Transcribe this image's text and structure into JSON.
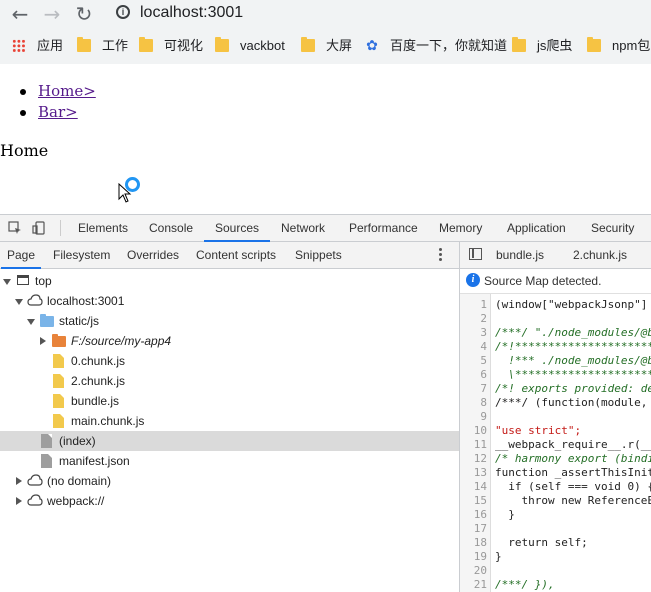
{
  "browser": {
    "url": "localhost:3001",
    "bookmarks": [
      {
        "label": "应用",
        "icon": "apps-grid-icon"
      },
      {
        "label": "工作",
        "icon": "folder-icon"
      },
      {
        "label": "可视化",
        "icon": "folder-icon"
      },
      {
        "label": "vackbot",
        "icon": "folder-icon"
      },
      {
        "label": "大屏",
        "icon": "folder-icon"
      },
      {
        "label": "百度一下，你就知道",
        "icon": "baidu-paw-icon"
      },
      {
        "label": "js爬虫",
        "icon": "folder-icon"
      },
      {
        "label": "npm包",
        "icon": "folder-icon"
      }
    ]
  },
  "page": {
    "links": [
      "Home>",
      "Bar>"
    ],
    "text": "Home"
  },
  "devtools": {
    "tabs": [
      "Elements",
      "Console",
      "Sources",
      "Network",
      "Performance",
      "Memory",
      "Application",
      "Security"
    ],
    "active_tab": "Sources",
    "sub_tabs": [
      "Page",
      "Filesystem",
      "Overrides",
      "Content scripts",
      "Snippets"
    ],
    "active_sub_tab": "Page",
    "tree": [
      {
        "label": "top",
        "depth": 0,
        "icon": "frame-icon",
        "expanded": true
      },
      {
        "label": "localhost:3001",
        "depth": 1,
        "icon": "cloud-icon",
        "expanded": true
      },
      {
        "label": "static/js",
        "depth": 2,
        "icon": "folder-icon",
        "expanded": true
      },
      {
        "label": "F:/source/my-app4",
        "depth": 3,
        "icon": "folder-icon",
        "expanded": false,
        "italic": true
      },
      {
        "label": "0.chunk.js",
        "depth": 4,
        "icon": "js-file-icon"
      },
      {
        "label": "2.chunk.js",
        "depth": 4,
        "icon": "js-file-icon"
      },
      {
        "label": "bundle.js",
        "depth": 4,
        "icon": "js-file-icon"
      },
      {
        "label": "main.chunk.js",
        "depth": 4,
        "icon": "js-file-icon"
      },
      {
        "label": "(index)",
        "depth": 3,
        "icon": "document-icon",
        "selected": true
      },
      {
        "label": "manifest.json",
        "depth": 3,
        "icon": "document-icon"
      },
      {
        "label": "(no domain)",
        "depth": 1,
        "icon": "cloud-icon",
        "expanded": false
      },
      {
        "label": "webpack://",
        "depth": 1,
        "icon": "cloud-icon",
        "expanded": false
      }
    ],
    "editor_tabs": [
      "bundle.js",
      "2.chunk.js"
    ],
    "source_map_notice": "Source Map detected.",
    "code_lines": [
      {
        "n": "1",
        "text": "(window[\"webpackJsonp\"]"
      },
      {
        "n": "2",
        "text": ""
      },
      {
        "n": "3",
        "text": "/***/ \"./node_modules/@b"
      },
      {
        "n": "4",
        "text": "/*!*********************"
      },
      {
        "n": "5",
        "text": "  !*** ./node_modules/@b"
      },
      {
        "n": "6",
        "text": "  \\*********************"
      },
      {
        "n": "7",
        "text": "/*! exports provided: de"
      },
      {
        "n": "8",
        "text": "/***/ (function(module, "
      },
      {
        "n": "9",
        "text": ""
      },
      {
        "n": "10",
        "text": "\"use strict\";"
      },
      {
        "n": "11",
        "text": "__webpack_require__.r(__"
      },
      {
        "n": "12",
        "text": "/* harmony export (bindi"
      },
      {
        "n": "13",
        "text": "function _assertThisInit"
      },
      {
        "n": "14",
        "text": "  if (self === void 0) {"
      },
      {
        "n": "15",
        "text": "    throw new ReferenceE"
      },
      {
        "n": "16",
        "text": "  }"
      },
      {
        "n": "17",
        "text": ""
      },
      {
        "n": "18",
        "text": "  return self;"
      },
      {
        "n": "19",
        "text": "}"
      },
      {
        "n": "20",
        "text": ""
      },
      {
        "n": "21",
        "text": "/***/ }),"
      }
    ]
  }
}
